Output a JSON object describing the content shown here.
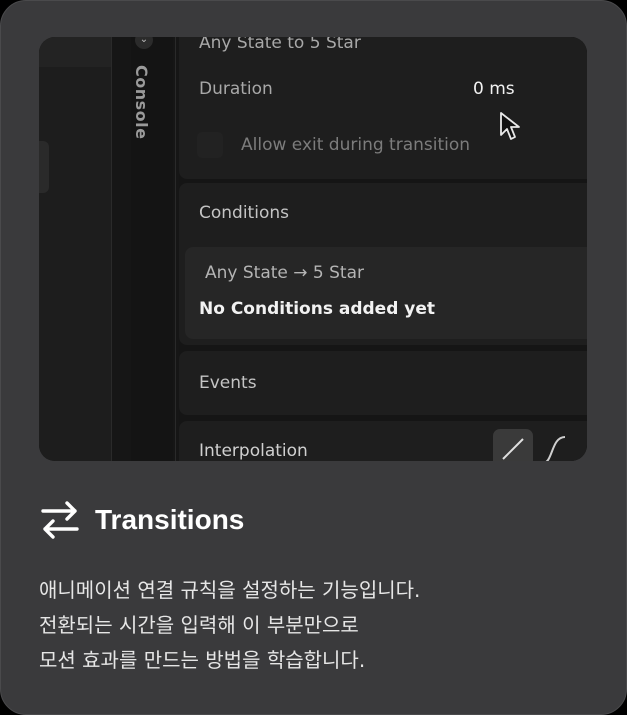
{
  "screenshot": {
    "console_label": "Console",
    "transition_title": "Any State to 5 Star",
    "duration_label": "Duration",
    "duration_value": "0 ms",
    "allow_exit_label": "Allow exit during transition",
    "conditions_label": "Conditions",
    "condition_title": "Any State → 5 Star",
    "condition_empty": "No Conditions added yet",
    "events_label": "Events",
    "interpolation_label": "Interpolation"
  },
  "feature": {
    "title": "Transitions",
    "icon": "swap-arrows-icon",
    "description": [
      "애니메이션 연결 규칙을 설정하는 기능입니다.",
      "전환되는 시간을 입력해 이 부분만으로",
      "모션 효과를 만드는 방법을 학습합니다."
    ]
  },
  "colors": {
    "card_bg": "#3a3a3c",
    "screenshot_bg": "#161616",
    "text_white": "#ffffff"
  }
}
